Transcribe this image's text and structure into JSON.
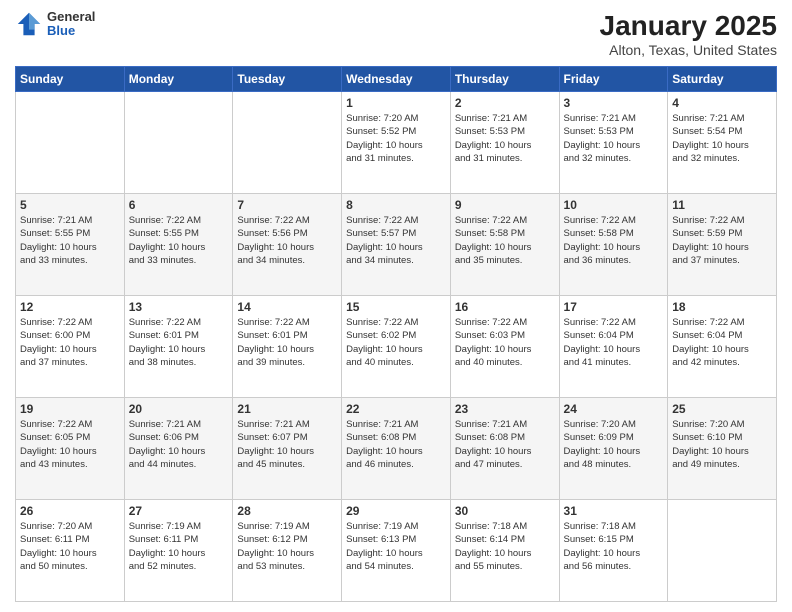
{
  "header": {
    "logo_general": "General",
    "logo_blue": "Blue",
    "title": "January 2025",
    "subtitle": "Alton, Texas, United States"
  },
  "days_of_week": [
    "Sunday",
    "Monday",
    "Tuesday",
    "Wednesday",
    "Thursday",
    "Friday",
    "Saturday"
  ],
  "weeks": [
    [
      {
        "day": "",
        "info": ""
      },
      {
        "day": "",
        "info": ""
      },
      {
        "day": "",
        "info": ""
      },
      {
        "day": "1",
        "info": "Sunrise: 7:20 AM\nSunset: 5:52 PM\nDaylight: 10 hours\nand 31 minutes."
      },
      {
        "day": "2",
        "info": "Sunrise: 7:21 AM\nSunset: 5:53 PM\nDaylight: 10 hours\nand 31 minutes."
      },
      {
        "day": "3",
        "info": "Sunrise: 7:21 AM\nSunset: 5:53 PM\nDaylight: 10 hours\nand 32 minutes."
      },
      {
        "day": "4",
        "info": "Sunrise: 7:21 AM\nSunset: 5:54 PM\nDaylight: 10 hours\nand 32 minutes."
      }
    ],
    [
      {
        "day": "5",
        "info": "Sunrise: 7:21 AM\nSunset: 5:55 PM\nDaylight: 10 hours\nand 33 minutes."
      },
      {
        "day": "6",
        "info": "Sunrise: 7:22 AM\nSunset: 5:55 PM\nDaylight: 10 hours\nand 33 minutes."
      },
      {
        "day": "7",
        "info": "Sunrise: 7:22 AM\nSunset: 5:56 PM\nDaylight: 10 hours\nand 34 minutes."
      },
      {
        "day": "8",
        "info": "Sunrise: 7:22 AM\nSunset: 5:57 PM\nDaylight: 10 hours\nand 34 minutes."
      },
      {
        "day": "9",
        "info": "Sunrise: 7:22 AM\nSunset: 5:58 PM\nDaylight: 10 hours\nand 35 minutes."
      },
      {
        "day": "10",
        "info": "Sunrise: 7:22 AM\nSunset: 5:58 PM\nDaylight: 10 hours\nand 36 minutes."
      },
      {
        "day": "11",
        "info": "Sunrise: 7:22 AM\nSunset: 5:59 PM\nDaylight: 10 hours\nand 37 minutes."
      }
    ],
    [
      {
        "day": "12",
        "info": "Sunrise: 7:22 AM\nSunset: 6:00 PM\nDaylight: 10 hours\nand 37 minutes."
      },
      {
        "day": "13",
        "info": "Sunrise: 7:22 AM\nSunset: 6:01 PM\nDaylight: 10 hours\nand 38 minutes."
      },
      {
        "day": "14",
        "info": "Sunrise: 7:22 AM\nSunset: 6:01 PM\nDaylight: 10 hours\nand 39 minutes."
      },
      {
        "day": "15",
        "info": "Sunrise: 7:22 AM\nSunset: 6:02 PM\nDaylight: 10 hours\nand 40 minutes."
      },
      {
        "day": "16",
        "info": "Sunrise: 7:22 AM\nSunset: 6:03 PM\nDaylight: 10 hours\nand 40 minutes."
      },
      {
        "day": "17",
        "info": "Sunrise: 7:22 AM\nSunset: 6:04 PM\nDaylight: 10 hours\nand 41 minutes."
      },
      {
        "day": "18",
        "info": "Sunrise: 7:22 AM\nSunset: 6:04 PM\nDaylight: 10 hours\nand 42 minutes."
      }
    ],
    [
      {
        "day": "19",
        "info": "Sunrise: 7:22 AM\nSunset: 6:05 PM\nDaylight: 10 hours\nand 43 minutes."
      },
      {
        "day": "20",
        "info": "Sunrise: 7:21 AM\nSunset: 6:06 PM\nDaylight: 10 hours\nand 44 minutes."
      },
      {
        "day": "21",
        "info": "Sunrise: 7:21 AM\nSunset: 6:07 PM\nDaylight: 10 hours\nand 45 minutes."
      },
      {
        "day": "22",
        "info": "Sunrise: 7:21 AM\nSunset: 6:08 PM\nDaylight: 10 hours\nand 46 minutes."
      },
      {
        "day": "23",
        "info": "Sunrise: 7:21 AM\nSunset: 6:08 PM\nDaylight: 10 hours\nand 47 minutes."
      },
      {
        "day": "24",
        "info": "Sunrise: 7:20 AM\nSunset: 6:09 PM\nDaylight: 10 hours\nand 48 minutes."
      },
      {
        "day": "25",
        "info": "Sunrise: 7:20 AM\nSunset: 6:10 PM\nDaylight: 10 hours\nand 49 minutes."
      }
    ],
    [
      {
        "day": "26",
        "info": "Sunrise: 7:20 AM\nSunset: 6:11 PM\nDaylight: 10 hours\nand 50 minutes."
      },
      {
        "day": "27",
        "info": "Sunrise: 7:19 AM\nSunset: 6:11 PM\nDaylight: 10 hours\nand 52 minutes."
      },
      {
        "day": "28",
        "info": "Sunrise: 7:19 AM\nSunset: 6:12 PM\nDaylight: 10 hours\nand 53 minutes."
      },
      {
        "day": "29",
        "info": "Sunrise: 7:19 AM\nSunset: 6:13 PM\nDaylight: 10 hours\nand 54 minutes."
      },
      {
        "day": "30",
        "info": "Sunrise: 7:18 AM\nSunset: 6:14 PM\nDaylight: 10 hours\nand 55 minutes."
      },
      {
        "day": "31",
        "info": "Sunrise: 7:18 AM\nSunset: 6:15 PM\nDaylight: 10 hours\nand 56 minutes."
      },
      {
        "day": "",
        "info": ""
      }
    ]
  ]
}
